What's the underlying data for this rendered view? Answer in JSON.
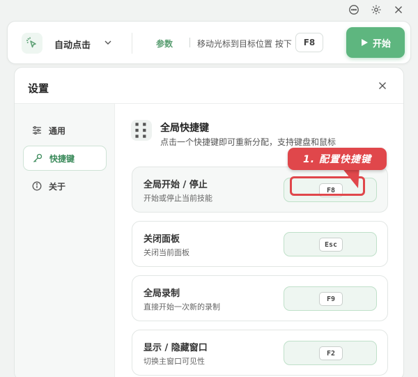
{
  "window": {
    "controls": [
      {
        "icon": "chat-icon"
      },
      {
        "icon": "gear-icon"
      },
      {
        "icon": "close-icon"
      }
    ]
  },
  "toolbar": {
    "mode_icon": "cursor-click-icon",
    "mode_label": "自动点击",
    "param_label": "参数",
    "hint": "移动光标到目标位置 按下",
    "hotkey": "F8",
    "start_label": "开始",
    "accent_color": "#5eb67f"
  },
  "dialog": {
    "title": "设置",
    "nav": [
      {
        "label": "通用",
        "icon": "sliders-icon",
        "active": false
      },
      {
        "label": "快捷键",
        "icon": "key-icon",
        "active": true
      },
      {
        "label": "关于",
        "icon": "info-icon",
        "active": false
      }
    ],
    "section": {
      "icon": "keyboard-icon",
      "title": "全局快捷键",
      "subtitle": "点击一个快捷键即可重新分配，支持键盘和鼠标"
    },
    "hotkeys": [
      {
        "title": "全局开始 / 停止",
        "desc": "开始或停止当前技能",
        "key": "F8"
      },
      {
        "title": "关闭面板",
        "desc": "关闭当前面板",
        "key": "Esc"
      },
      {
        "title": "全局录制",
        "desc": "直接开始一次新的录制",
        "key": "F9"
      },
      {
        "title": "显示 / 隐藏窗口",
        "desc": "切换主窗口可见性",
        "key": "F2"
      }
    ]
  },
  "annotation": {
    "label": "1. 配置快捷键",
    "color": "#e0474b"
  }
}
